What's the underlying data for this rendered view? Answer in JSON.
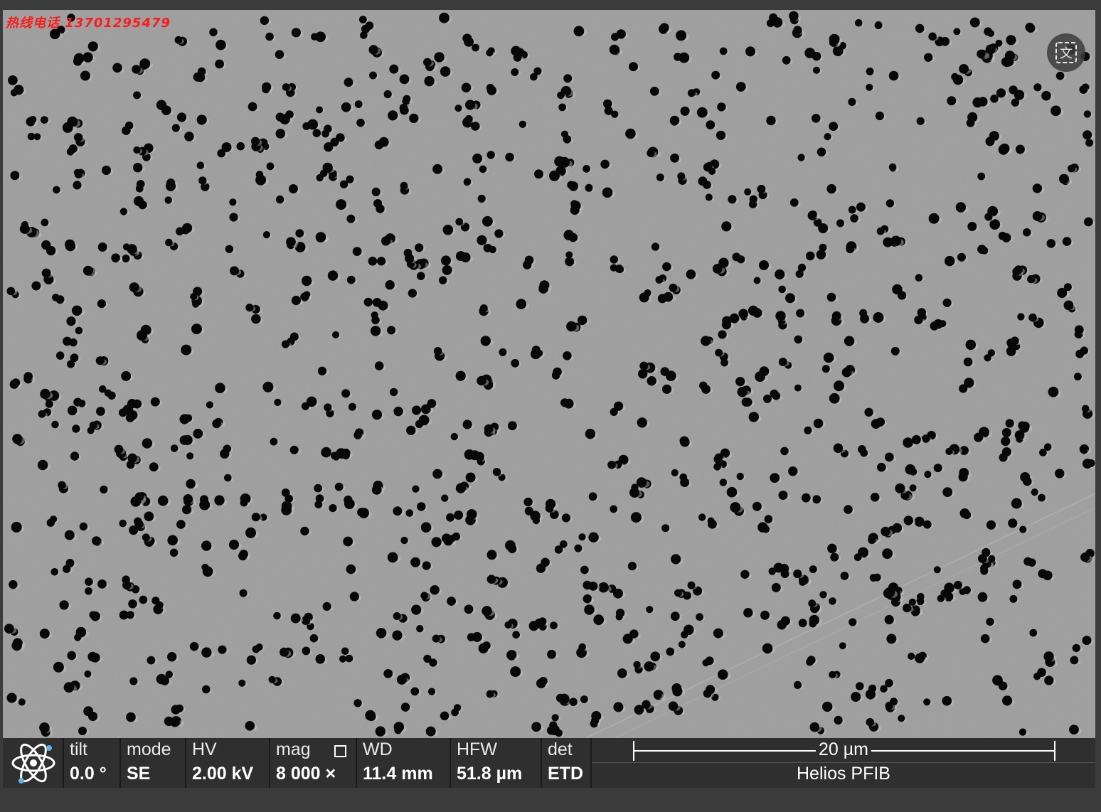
{
  "watermark": "热线电话 13701295479",
  "image": {
    "description_free": true,
    "pore_color": "#080808",
    "background_color": "#9a9a9a"
  },
  "translate_button": {
    "icon": "translate-icon",
    "glyph": "文"
  },
  "databar": {
    "logo_icon": "atom-icon",
    "tilt": {
      "label": "tilt",
      "value": "0.0 °"
    },
    "mode": {
      "label": "mode",
      "value": "SE"
    },
    "hv": {
      "label": "HV",
      "value": "2.00 kV"
    },
    "mag": {
      "label": "mag",
      "value": "8 000 ×"
    },
    "wd": {
      "label": "WD",
      "value": "11.4 mm"
    },
    "hfw": {
      "label": "HFW",
      "value": "51.8 µm"
    },
    "det": {
      "label": "det",
      "value": "ETD"
    },
    "scale_bar": "20 µm",
    "instrument": "Helios PFIB"
  }
}
